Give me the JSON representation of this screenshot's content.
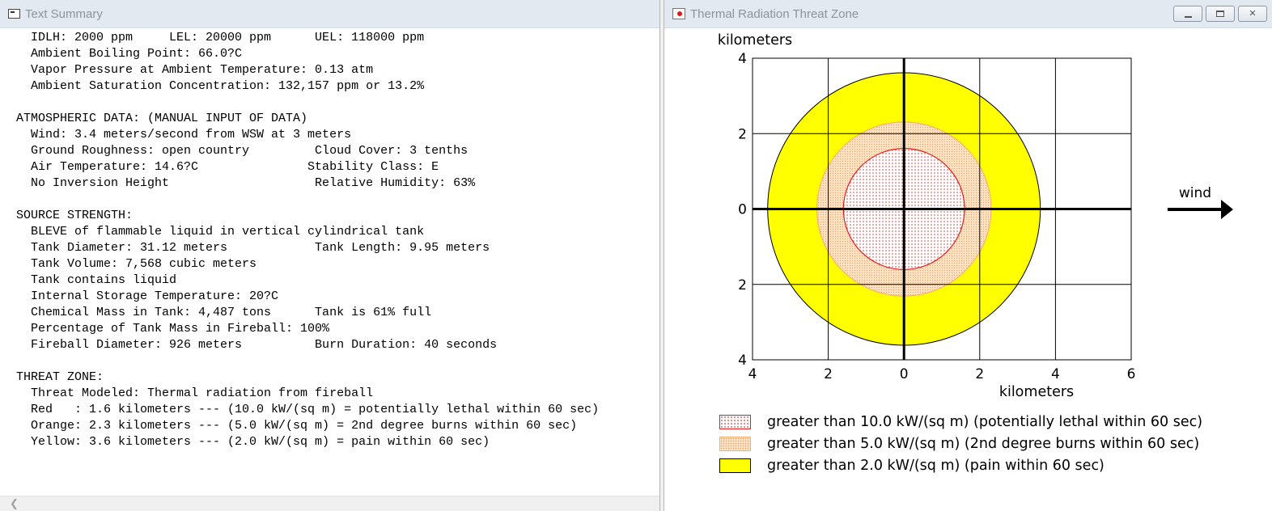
{
  "left_window": {
    "title": "Text Summary",
    "lines": [
      "  IDLH: 2000 ppm     LEL: 20000 ppm      UEL: 118000 ppm",
      "  Ambient Boiling Point: 66.0?C",
      "  Vapor Pressure at Ambient Temperature: 0.13 atm",
      "  Ambient Saturation Concentration: 132,157 ppm or 13.2%",
      "",
      "ATMOSPHERIC DATA: (MANUAL INPUT OF DATA)",
      "  Wind: 3.4 meters/second from WSW at 3 meters",
      "  Ground Roughness: open country         Cloud Cover: 3 tenths",
      "  Air Temperature: 14.6?C               Stability Class: E",
      "  No Inversion Height                    Relative Humidity: 63%",
      "",
      "SOURCE STRENGTH:",
      "  BLEVE of flammable liquid in vertical cylindrical tank",
      "  Tank Diameter: 31.12 meters            Tank Length: 9.95 meters",
      "  Tank Volume: 7,568 cubic meters",
      "  Tank contains liquid",
      "  Internal Storage Temperature: 20?C",
      "  Chemical Mass in Tank: 4,487 tons      Tank is 61% full",
      "  Percentage of Tank Mass in Fireball: 100%",
      "  Fireball Diameter: 926 meters          Burn Duration: 40 seconds",
      "",
      "THREAT ZONE:",
      "  Threat Modeled: Thermal radiation from fireball",
      "  Red   : 1.6 kilometers --- (10.0 kW/(sq m) = potentially lethal within 60 sec)",
      "  Orange: 2.3 kilometers --- (5.0 kW/(sq m) = 2nd degree burns within 60 sec)",
      "  Yellow: 3.6 kilometers --- (2.0 kW/(sq m) = pain within 60 sec)"
    ]
  },
  "right_window": {
    "title": "Thermal Radiation Threat Zone",
    "buttons": [
      "minimize",
      "restore",
      "close"
    ]
  },
  "chart_data": {
    "type": "threat-zone",
    "title": "",
    "xlabel": "kilometers",
    "ylabel": "kilometers",
    "xlim": [
      -4,
      6
    ],
    "ylim": [
      -4,
      4
    ],
    "x_ticks": [
      -4,
      -2,
      0,
      2,
      4,
      6
    ],
    "x_tick_labels": [
      "4",
      "2",
      "0",
      "2",
      "4",
      "6"
    ],
    "y_ticks": [
      4,
      2,
      0,
      -2,
      -4
    ],
    "y_tick_labels": [
      "4",
      "2",
      "0",
      "2",
      "4"
    ],
    "grid": true,
    "wind_label": "wind",
    "wind_direction": "right",
    "zones": [
      {
        "name": "Yellow",
        "radius_km": 3.6,
        "color": "#ffff00",
        "edge": "#000000",
        "pattern": "solid"
      },
      {
        "name": "Orange",
        "radius_km": 2.3,
        "color": "#ffe2c0",
        "edge": "#ffb070",
        "pattern": "dots"
      },
      {
        "name": "Red",
        "radius_km": 1.6,
        "color": "#ffffff",
        "edge": "#e51b1b",
        "pattern": "dots"
      }
    ],
    "legend": [
      {
        "swatch": "red",
        "label": "greater than 10.0 kW/(sq m) (potentially lethal within 60 sec)"
      },
      {
        "swatch": "orange",
        "label": "greater than 5.0 kW/(sq m) (2nd degree burns within 60 sec)"
      },
      {
        "swatch": "yellow",
        "label": "greater than 2.0 kW/(sq m) (pain within 60 sec)"
      }
    ]
  }
}
